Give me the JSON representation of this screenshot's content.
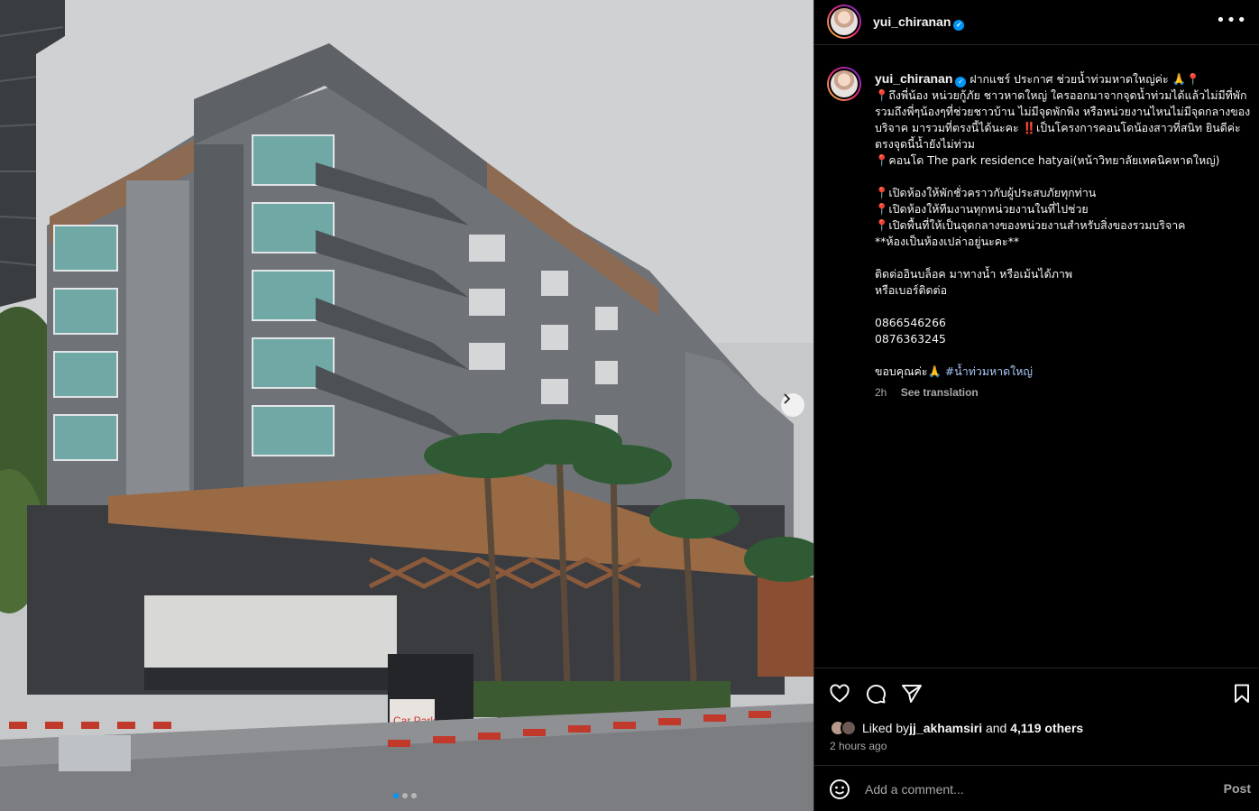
{
  "post": {
    "username": "yui_chiranan",
    "more_icon": "more-horizontal-icon"
  },
  "caption": {
    "username": "yui_chiranan",
    "lines": [
      "ฝากแชร์ ประกาศ ช่วยน้ำท่วมหาดใหญ่ค่ะ 🙏📍",
      "📍ถึงพี่น้อง หน่วยกู้ภัย ชาวหาดใหญ่ ใครออกมาจากจุดน้ำท่วมได้แล้วไม่มีที่พัก รวมถึงพี่ๆน้องๆที่ช่วยชาวบ้าน ไม่มีจุดพักพิง หรือหน่วยงานไหนไม่มีจุดกลางของบริจาค มารวมที่ตรงนี้ได้นะคะ ‼️เป็นโครงการคอนโดน้องสาวที่สนิท ยินดีค่ะ ตรงจุดนี้น้ำยังไม่ท่วม",
      "📍คอนโด The park residence hatyai(หน้าวิทยาลัยเทคนิคหาดใหญ่)",
      "",
      "📍เปิดห้องให้พักชั่วคราวกับผู้ประสบภัยทุกท่าน",
      "📍เปิดห้องให้ทีมงานทุกหน่วยงานในที่ไปช่วย",
      "📍เปิดพื้นที่ให้เป็นจุดกลางของหน่วยงานสำหรับสิ่งของรวมบริจาค",
      "**ห้องเป็นห้องเปล่าอยู่นะคะ**",
      "",
      "ติดต่ออินบล็อค มาทางน้ำ หรือเม้นได้ภาพ",
      "หรือเบอร์ติดต่อ",
      "",
      "0866546266",
      "0876363245",
      "",
      "ขอบคุณค่ะ🙏"
    ],
    "hashtag": "#น้ำท่วมหาดใหญ่",
    "age": "2h",
    "see_translation": "See translation"
  },
  "actions": {
    "like_icon": "heart-icon",
    "comment_icon": "comment-icon",
    "share_icon": "share-icon",
    "save_icon": "bookmark-icon"
  },
  "likes": {
    "prefix": "Liked by ",
    "user": "jj_akhamsiri",
    "middle": " and ",
    "count": "4,119 others"
  },
  "time_ago": "2 hours ago",
  "comment": {
    "placeholder": "Add a comment...",
    "post_label": "Post"
  },
  "photo": {
    "sign_text": "Car Park",
    "slide_count": 3,
    "active_slide": 1
  },
  "colors": {
    "accent": "#0095f6",
    "background": "#000000",
    "muted": "#a8a8a8"
  }
}
